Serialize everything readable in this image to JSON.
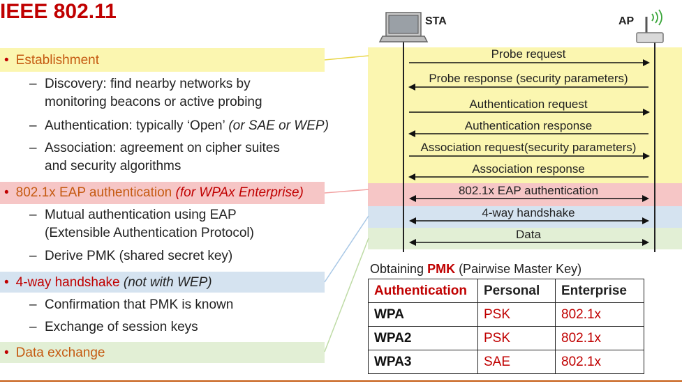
{
  "title": "IEEE 802.11",
  "sections": [
    {
      "label": "Establishment",
      "suffix": "",
      "items": [
        [
          "Discovery: find nearby networks by",
          "monitoring beacons or active probing"
        ],
        [
          "Authentication: typically ‘Open’ ",
          "(or SAE or WEP)"
        ],
        [
          "Association: agreement on cipher suites",
          "and security algorithms"
        ]
      ]
    },
    {
      "label": "802.1x EAP authentication ",
      "suffix": "(for WPAx Enterprise)",
      "items": [
        [
          "Mutual authentication using EAP",
          "(Extensible Authentication Protocol)"
        ],
        [
          "Derive PMK (shared secret key)"
        ]
      ]
    },
    {
      "label": "4-way handshake ",
      "suffix": "(not with WEP)",
      "items": [
        [
          "Confirmation that PMK is known"
        ],
        [
          "Exchange of session keys"
        ]
      ]
    },
    {
      "label": "Data exchange",
      "suffix": "",
      "items": []
    }
  ],
  "diagram": {
    "sta_label": "STA",
    "ap_label": "AP",
    "messages": [
      "Probe request",
      "Probe response (security parameters)",
      "Authentication request",
      "Authentication response",
      "Association request(security parameters)",
      "Association response",
      "802.1x EAP authentication",
      "4-way handshake",
      "Data"
    ]
  },
  "table": {
    "title_prefix": "Obtaining ",
    "title_key": "PMK",
    "title_suffix": " (Pairwise Master Key)",
    "headers": [
      "Authentication",
      "Personal",
      "Enterprise"
    ],
    "rows": [
      [
        "WPA",
        "PSK",
        "802.1x"
      ],
      [
        "WPA2",
        "PSK",
        "802.1x"
      ],
      [
        "WPA3",
        "SAE",
        "802.1x"
      ]
    ]
  },
  "colors": {
    "yellow": "#fbf6b0",
    "red": "#f6c6c6",
    "blue": "#d5e3f0",
    "green": "#e2efd5",
    "title": "#c00000",
    "bullet_text": "#c55a11"
  }
}
